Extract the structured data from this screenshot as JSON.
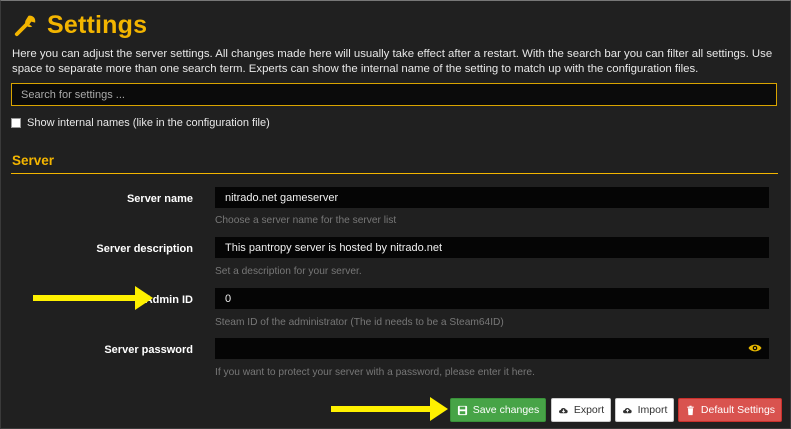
{
  "header": {
    "icon": "wrench-icon",
    "title": "Settings",
    "title_color": "#f3b500",
    "intro": "Here you can adjust the server settings. All changes made here will usually take effect after a restart. With the search bar you can filter all settings. Use space to separate more than one search term. Experts can show the internal name of the setting to match up with the configuration files."
  },
  "search": {
    "placeholder": "Search for settings ...",
    "value": ""
  },
  "internal_names": {
    "label": "Show internal names (like in the configuration file)",
    "checked": false
  },
  "section": {
    "title": "Server",
    "fields": [
      {
        "label": "Server name",
        "value": "nitrado.net gameserver",
        "hint": "Choose a server name for the server list"
      },
      {
        "label": "Server description",
        "value": "This pantropy server is hosted by nitrado.net",
        "hint": "Set a description for your server."
      },
      {
        "label": "Admin ID",
        "value": "0",
        "hint": "Steam ID of the administrator (The id needs to be a Steam64ID)"
      },
      {
        "label": "Server password",
        "value": "",
        "hint": "If you want to protect your server with a password, please enter it here.",
        "icon": "eye-icon"
      }
    ]
  },
  "actions": {
    "save": {
      "label": "Save changes",
      "icon": "save-icon",
      "color": "#47a447"
    },
    "export": {
      "label": "Export",
      "icon": "cloud-download-icon"
    },
    "import": {
      "label": "Import",
      "icon": "cloud-upload-icon"
    },
    "default": {
      "label": "Default Settings",
      "icon": "trash-icon",
      "color": "#d9534f"
    }
  },
  "annotations": {
    "arrow_color": "#fff100"
  }
}
